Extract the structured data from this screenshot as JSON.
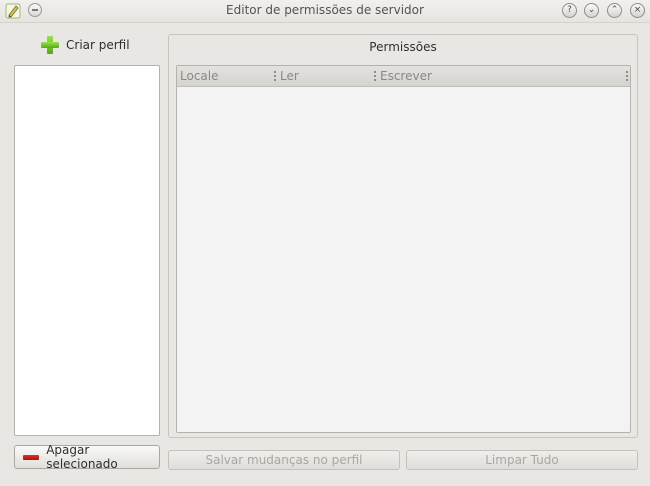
{
  "window": {
    "title": "Editor de permissões de servidor"
  },
  "titlebar_buttons": {
    "help": "?",
    "minimize": "⌄",
    "maximize": "⌃",
    "close": "×"
  },
  "left": {
    "create_label": "Criar perfil",
    "delete_label": "Apagar selecionado",
    "profiles": []
  },
  "permissions": {
    "title": "Permissões",
    "columns": [
      "Locale",
      "Ler",
      "Escrever"
    ],
    "rows": []
  },
  "actions": {
    "save_label": "Salvar mudanças no perfil",
    "clear_label": "Limpar Tudo"
  },
  "colors": {
    "add": "#6cc024",
    "remove": "#d0201b",
    "disabled_text": "#a9a7a3"
  },
  "icons": {
    "app": "pencil-icon",
    "menu": "window-menu-icon",
    "add": "plus-icon",
    "remove": "minus-icon"
  }
}
